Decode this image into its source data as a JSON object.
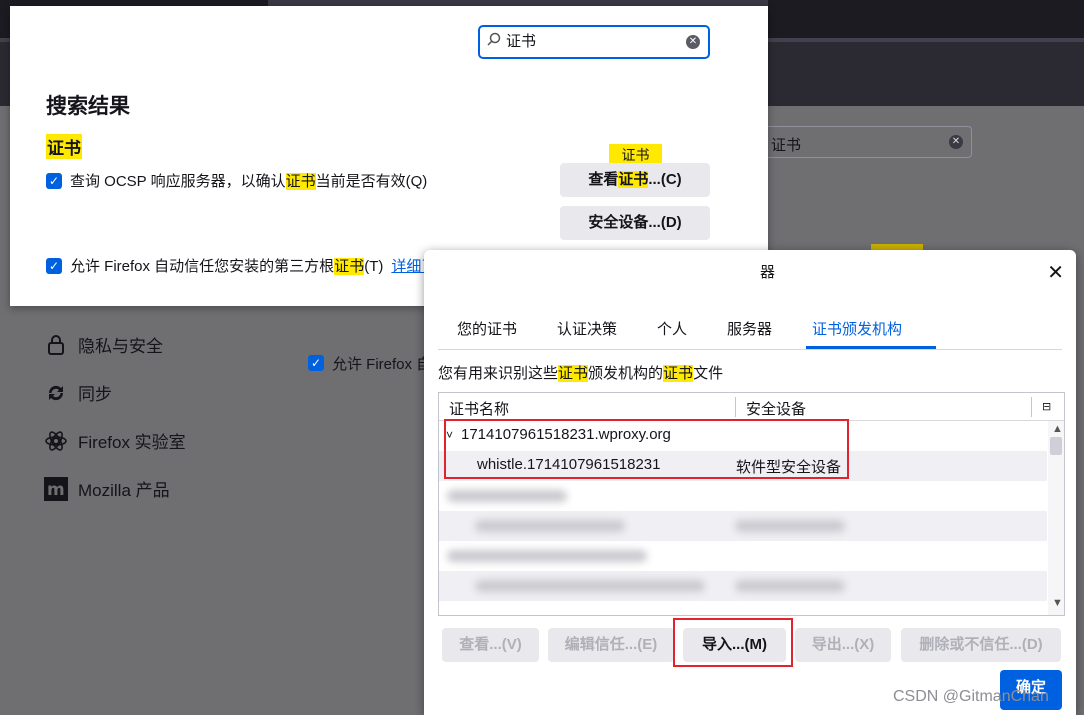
{
  "overlay": {
    "search_value": "证书",
    "title": "搜索结果",
    "section": "证书",
    "ocsp": {
      "prefix": "查询 OCSP 响应服务器，以确认",
      "highlight": "证书",
      "suffix": "当前是否有效(Q)"
    },
    "thirdparty": {
      "prefix": "允许 Firefox 自动信任您安装的第三方根",
      "highlight": "证书",
      "suffix": "(T)",
      "link": "详细了解"
    },
    "tooltip": "证书",
    "view_btn": {
      "prefix": "查看",
      "highlight": "证书",
      "suffix": "...(C)"
    },
    "devices_btn": "安全设备...(D)"
  },
  "background": {
    "search_value": "证书",
    "sidebar": [
      {
        "icon": "lock-icon",
        "glyph": "🔒",
        "label": "隐私与安全"
      },
      {
        "icon": "sync-icon",
        "glyph": "⟳",
        "label": "同步"
      },
      {
        "icon": "flask-icon",
        "glyph": "⚗",
        "label": "Firefox 实验室"
      },
      {
        "icon": "mozilla-icon",
        "glyph": "m",
        "label": "Mozilla 产品"
      }
    ],
    "checkbox_text": "允许 Firefox 自"
  },
  "dialog": {
    "title_fragment": "器",
    "tabs": [
      "您的证书",
      "认证决策",
      "个人",
      "服务器",
      "证书颁发机构"
    ],
    "active_tab": "证书颁发机构",
    "description": {
      "p1": "您有用来识别这些",
      "h1": "证书",
      "p2": "颁发机构的",
      "h2": "证书",
      "p3": "文件"
    },
    "columns": [
      "证书名称",
      "安全设备"
    ],
    "rows": [
      {
        "name": "1714107961518231.wproxy.org",
        "device": "",
        "expander": "˅"
      },
      {
        "name": "whistle.1714107961518231",
        "device": "软件型安全设备"
      }
    ],
    "buttons": [
      "查看...(V)",
      "编辑信任...(E)",
      "导入...(M)",
      "导出...(X)",
      "删除或不信任...(D)"
    ],
    "ok_label": "确定"
  },
  "watermark": "CSDN @GitmanChan",
  "colors": {
    "accent": "#0061e0",
    "highlight": "#ffe900",
    "annotation": "#e0232e"
  }
}
